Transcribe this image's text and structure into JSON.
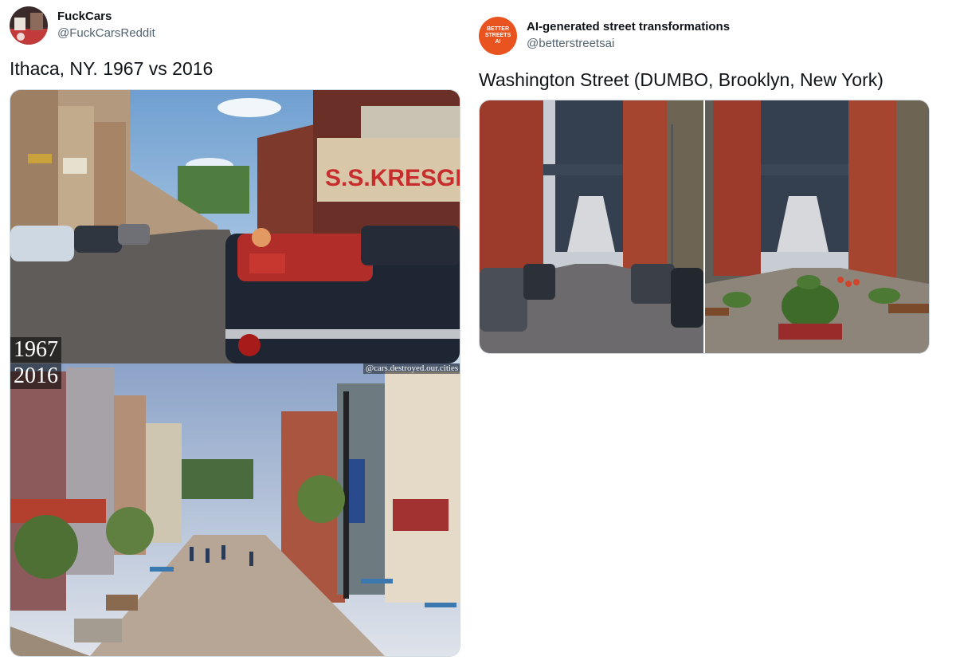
{
  "tweets": [
    {
      "author_name": "FuckCars",
      "author_handle": "@FuckCarsReddit",
      "text": "Ithaca, NY. 1967 vs 2016",
      "media": {
        "label_top": "1967",
        "label_bottom": "2016",
        "credit": "@cars.destroyed.our.cities",
        "sign_text": "S.S.KRESGE CO."
      }
    },
    {
      "author_name": "AI-generated street transformations",
      "author_handle": "@betterstreetsai",
      "avatar_text": [
        "BETTER",
        "STREETS",
        "AI"
      ],
      "text": "Washington Street (DUMBO, Brooklyn, New York)"
    }
  ],
  "colors": {
    "name": "#0f1419",
    "handle": "#536471",
    "avatar_orange": "#e8531f",
    "border": "#cfd9de"
  }
}
